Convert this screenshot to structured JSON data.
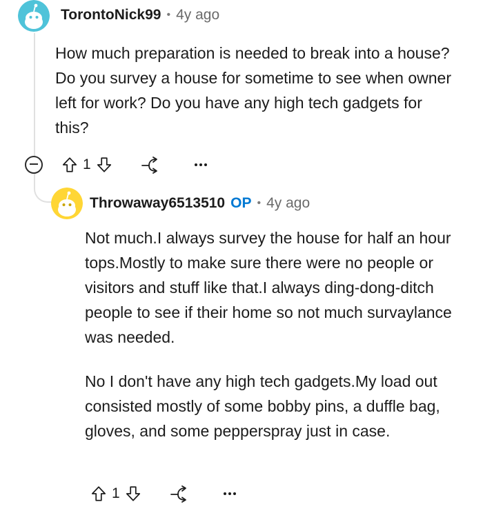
{
  "comments": [
    {
      "username": "TorontoNick99",
      "separator": "•",
      "time": "4y ago",
      "body": "How much preparation is needed to break into a house? Do you survey a house for sometime to see when owner left for work? Do you have any high tech gadgets for this?",
      "votes": "1",
      "avatar_color": "#4fc3d9"
    },
    {
      "username": "Throwaway6513510",
      "op_badge": "OP",
      "separator": "•",
      "time": "4y ago",
      "paragraphs": [
        "Not much.I always survey the house for half an hour tops.Mostly to make sure there were no people or visitors and stuff like that.I always ding-dong-ditch people to see if their home so not much survaylance was needed.",
        "No I don't have any high tech gadgets.My load out consisted mostly of some bobby pins, a duffle bag, gloves, and some pepperspray just in case."
      ],
      "votes": "1",
      "avatar_color": "#ffd635"
    }
  ],
  "icons": {
    "upvote": "arrow-up-icon",
    "downvote": "arrow-down-icon",
    "share": "share-icon",
    "more": "more-options-icon",
    "collapse": "collapse-icon"
  },
  "colors": {
    "op_badge": "#0079d3",
    "thread_line": "#e0e0e0"
  }
}
